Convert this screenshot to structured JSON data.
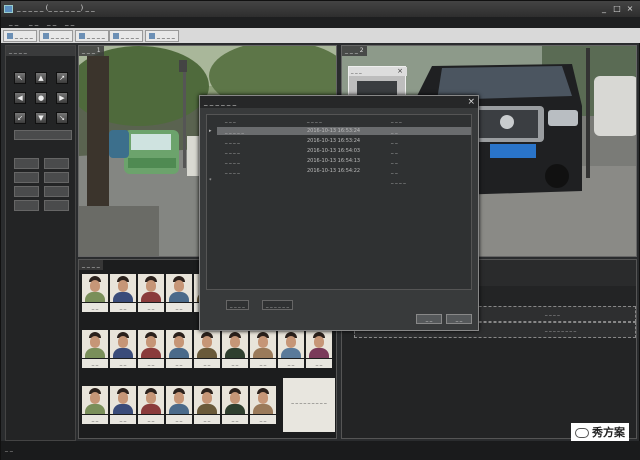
{
  "window": {
    "title": "_ _ _ _ _ (_ _ _ _ _ _) _ _",
    "min": "_",
    "max": "□",
    "close": "×"
  },
  "menu": [
    {
      "label": "_ _"
    },
    {
      "label": "_ _"
    },
    {
      "label": "_ _"
    },
    {
      "label": "_ _"
    }
  ],
  "toolbar": {
    "tabs": [
      {
        "label": "_ _ _ _"
      },
      {
        "label": "_ _ _ _"
      },
      {
        "label": "_ _ _ _"
      },
      {
        "label": "_ _ _ _"
      },
      {
        "label": "_ _ _ _"
      }
    ]
  },
  "left_panel": {
    "title": "_ _ _ _"
  },
  "ptz": {
    "up_left": "↖",
    "up": "▲",
    "up_right": "↗",
    "left": "◀",
    "center": "●",
    "right": "▶",
    "down_left": "↙",
    "down": "▼",
    "down_right": "↘"
  },
  "video_left": {
    "label": "_ _ _ 1"
  },
  "video_right": {
    "label": "_ _ _ 2",
    "inset_label": "_ _ _",
    "inset_close": "×"
  },
  "face_panel": {
    "label": "_ _ _ _",
    "captions": [
      "_ _",
      "_ _",
      "_ _",
      "_ _",
      "_ _",
      "_ _",
      "_ _",
      "_ _",
      "_ _",
      "_ _",
      "_ _",
      "_ _",
      "_ _",
      "_ _",
      "_ _",
      "_ _",
      "_ _",
      "_ _",
      "_ _",
      "_ _",
      "_ _",
      "_ _",
      "_ _",
      "_ _",
      "_ _",
      "_ _",
      "_ _"
    ],
    "overlay_text": "_ _ _ _ _ _ _ _ _"
  },
  "right_lower": {
    "row1": "_ _ _ _",
    "row2": "_ _ _ _ _ _ _ _"
  },
  "dialog": {
    "title": "_ _ _ _ _ _",
    "close": "×",
    "headers": [
      "_ _ _",
      "_ _ _ _",
      "_ _ _"
    ],
    "rows": [
      {
        "marker": "▸",
        "name": "_ _ _ _ _",
        "time": "2016-10-13 16:53:24",
        "status": "_ _"
      },
      {
        "marker": "",
        "name": "_ _ _ _",
        "time": "2016-10-13 16:53:24",
        "status": "_ _"
      },
      {
        "marker": "",
        "name": "_ _ _ _",
        "time": "2016-10-13 16:54:03",
        "status": "_ _"
      },
      {
        "marker": "",
        "name": "_ _ _ _",
        "time": "2016-10-13 16:54:13",
        "status": "_ _"
      },
      {
        "marker": "",
        "name": "_ _ _ _",
        "time": "2016-10-13 16:54:22",
        "status": "_ _"
      },
      {
        "marker": "*",
        "name": "",
        "time": "",
        "status": "_ _ _ _"
      }
    ],
    "tabs": [
      "_ _ _ _",
      "_ _ _ _ _ _"
    ],
    "ok": "_ _",
    "cancel": "_ _"
  },
  "status": {
    "text": "_ _"
  },
  "brand": {
    "text": "秀方案"
  }
}
